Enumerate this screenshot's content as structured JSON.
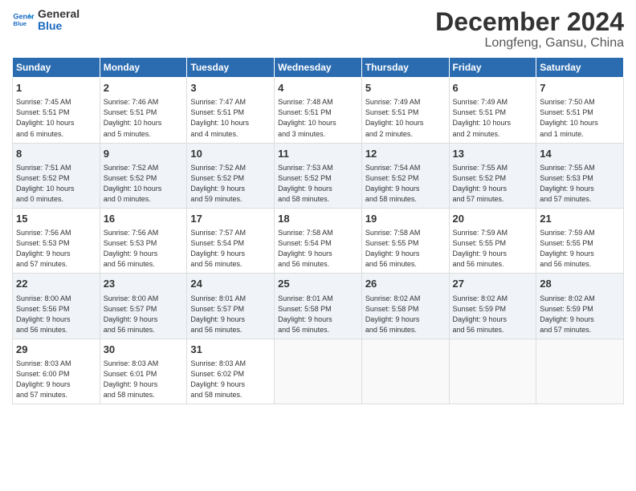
{
  "logo": {
    "line1": "General",
    "line2": "Blue"
  },
  "title": "December 2024",
  "location": "Longfeng, Gansu, China",
  "header": {
    "cols": [
      "Sunday",
      "Monday",
      "Tuesday",
      "Wednesday",
      "Thursday",
      "Friday",
      "Saturday"
    ]
  },
  "weeks": [
    [
      {
        "day": "1",
        "lines": [
          "Sunrise: 7:45 AM",
          "Sunset: 5:51 PM",
          "Daylight: 10 hours",
          "and 6 minutes."
        ]
      },
      {
        "day": "2",
        "lines": [
          "Sunrise: 7:46 AM",
          "Sunset: 5:51 PM",
          "Daylight: 10 hours",
          "and 5 minutes."
        ]
      },
      {
        "day": "3",
        "lines": [
          "Sunrise: 7:47 AM",
          "Sunset: 5:51 PM",
          "Daylight: 10 hours",
          "and 4 minutes."
        ]
      },
      {
        "day": "4",
        "lines": [
          "Sunrise: 7:48 AM",
          "Sunset: 5:51 PM",
          "Daylight: 10 hours",
          "and 3 minutes."
        ]
      },
      {
        "day": "5",
        "lines": [
          "Sunrise: 7:49 AM",
          "Sunset: 5:51 PM",
          "Daylight: 10 hours",
          "and 2 minutes."
        ]
      },
      {
        "day": "6",
        "lines": [
          "Sunrise: 7:49 AM",
          "Sunset: 5:51 PM",
          "Daylight: 10 hours",
          "and 2 minutes."
        ]
      },
      {
        "day": "7",
        "lines": [
          "Sunrise: 7:50 AM",
          "Sunset: 5:51 PM",
          "Daylight: 10 hours",
          "and 1 minute."
        ]
      }
    ],
    [
      {
        "day": "8",
        "lines": [
          "Sunrise: 7:51 AM",
          "Sunset: 5:52 PM",
          "Daylight: 10 hours",
          "and 0 minutes."
        ]
      },
      {
        "day": "9",
        "lines": [
          "Sunrise: 7:52 AM",
          "Sunset: 5:52 PM",
          "Daylight: 10 hours",
          "and 0 minutes."
        ]
      },
      {
        "day": "10",
        "lines": [
          "Sunrise: 7:52 AM",
          "Sunset: 5:52 PM",
          "Daylight: 9 hours",
          "and 59 minutes."
        ]
      },
      {
        "day": "11",
        "lines": [
          "Sunrise: 7:53 AM",
          "Sunset: 5:52 PM",
          "Daylight: 9 hours",
          "and 58 minutes."
        ]
      },
      {
        "day": "12",
        "lines": [
          "Sunrise: 7:54 AM",
          "Sunset: 5:52 PM",
          "Daylight: 9 hours",
          "and 58 minutes."
        ]
      },
      {
        "day": "13",
        "lines": [
          "Sunrise: 7:55 AM",
          "Sunset: 5:52 PM",
          "Daylight: 9 hours",
          "and 57 minutes."
        ]
      },
      {
        "day": "14",
        "lines": [
          "Sunrise: 7:55 AM",
          "Sunset: 5:53 PM",
          "Daylight: 9 hours",
          "and 57 minutes."
        ]
      }
    ],
    [
      {
        "day": "15",
        "lines": [
          "Sunrise: 7:56 AM",
          "Sunset: 5:53 PM",
          "Daylight: 9 hours",
          "and 57 minutes."
        ]
      },
      {
        "day": "16",
        "lines": [
          "Sunrise: 7:56 AM",
          "Sunset: 5:53 PM",
          "Daylight: 9 hours",
          "and 56 minutes."
        ]
      },
      {
        "day": "17",
        "lines": [
          "Sunrise: 7:57 AM",
          "Sunset: 5:54 PM",
          "Daylight: 9 hours",
          "and 56 minutes."
        ]
      },
      {
        "day": "18",
        "lines": [
          "Sunrise: 7:58 AM",
          "Sunset: 5:54 PM",
          "Daylight: 9 hours",
          "and 56 minutes."
        ]
      },
      {
        "day": "19",
        "lines": [
          "Sunrise: 7:58 AM",
          "Sunset: 5:55 PM",
          "Daylight: 9 hours",
          "and 56 minutes."
        ]
      },
      {
        "day": "20",
        "lines": [
          "Sunrise: 7:59 AM",
          "Sunset: 5:55 PM",
          "Daylight: 9 hours",
          "and 56 minutes."
        ]
      },
      {
        "day": "21",
        "lines": [
          "Sunrise: 7:59 AM",
          "Sunset: 5:55 PM",
          "Daylight: 9 hours",
          "and 56 minutes."
        ]
      }
    ],
    [
      {
        "day": "22",
        "lines": [
          "Sunrise: 8:00 AM",
          "Sunset: 5:56 PM",
          "Daylight: 9 hours",
          "and 56 minutes."
        ]
      },
      {
        "day": "23",
        "lines": [
          "Sunrise: 8:00 AM",
          "Sunset: 5:57 PM",
          "Daylight: 9 hours",
          "and 56 minutes."
        ]
      },
      {
        "day": "24",
        "lines": [
          "Sunrise: 8:01 AM",
          "Sunset: 5:57 PM",
          "Daylight: 9 hours",
          "and 56 minutes."
        ]
      },
      {
        "day": "25",
        "lines": [
          "Sunrise: 8:01 AM",
          "Sunset: 5:58 PM",
          "Daylight: 9 hours",
          "and 56 minutes."
        ]
      },
      {
        "day": "26",
        "lines": [
          "Sunrise: 8:02 AM",
          "Sunset: 5:58 PM",
          "Daylight: 9 hours",
          "and 56 minutes."
        ]
      },
      {
        "day": "27",
        "lines": [
          "Sunrise: 8:02 AM",
          "Sunset: 5:59 PM",
          "Daylight: 9 hours",
          "and 56 minutes."
        ]
      },
      {
        "day": "28",
        "lines": [
          "Sunrise: 8:02 AM",
          "Sunset: 5:59 PM",
          "Daylight: 9 hours",
          "and 57 minutes."
        ]
      }
    ],
    [
      {
        "day": "29",
        "lines": [
          "Sunrise: 8:03 AM",
          "Sunset: 6:00 PM",
          "Daylight: 9 hours",
          "and 57 minutes."
        ]
      },
      {
        "day": "30",
        "lines": [
          "Sunrise: 8:03 AM",
          "Sunset: 6:01 PM",
          "Daylight: 9 hours",
          "and 58 minutes."
        ]
      },
      {
        "day": "31",
        "lines": [
          "Sunrise: 8:03 AM",
          "Sunset: 6:02 PM",
          "Daylight: 9 hours",
          "and 58 minutes."
        ]
      },
      null,
      null,
      null,
      null
    ]
  ]
}
